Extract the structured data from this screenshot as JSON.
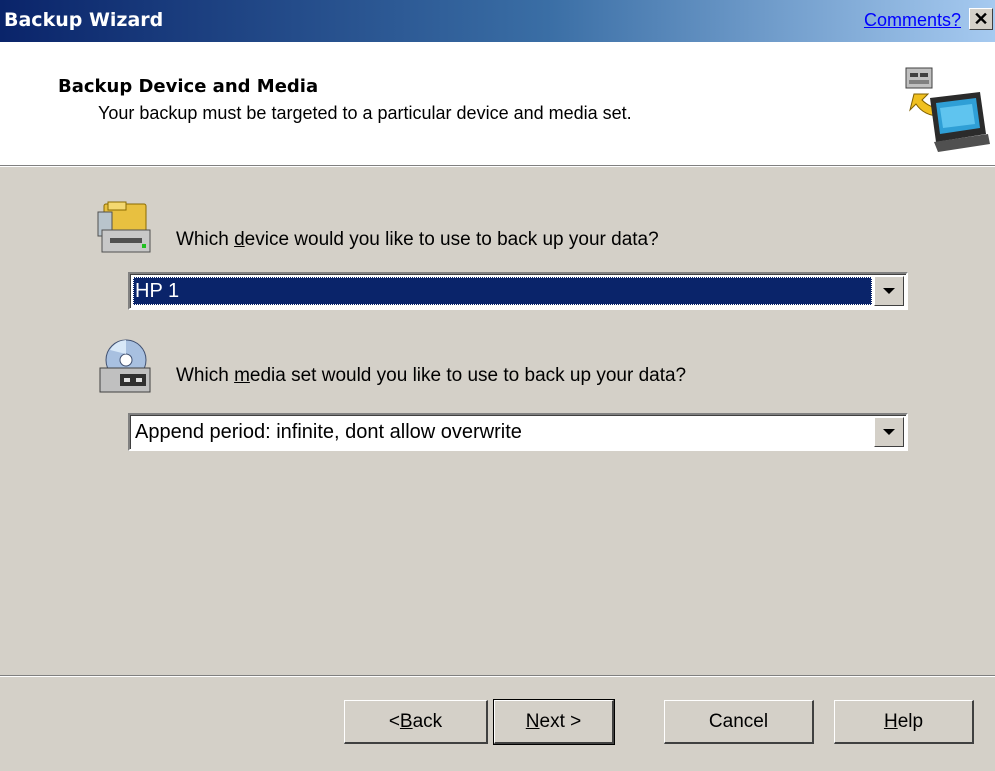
{
  "window": {
    "title": "Backup Wizard",
    "comments_link": "Comments?",
    "close_symbol": "✕"
  },
  "header": {
    "title": "Backup Device and Media",
    "subtitle": "Your backup must be targeted to a particular device and media set.",
    "icon": "backup-computer-icon"
  },
  "device_question": {
    "pre": "Which ",
    "mnemonic": "d",
    "post": "evice would you like to use to back up your data?",
    "icon": "device-icon"
  },
  "device_select": {
    "value": "HP 1",
    "selected": true
  },
  "media_question": {
    "pre": "Which ",
    "mnemonic": "m",
    "post": "edia set would you like to use to back up your data?",
    "icon": "media-set-icon"
  },
  "media_select": {
    "value": "Append period: infinite, dont allow overwrite"
  },
  "buttons": {
    "back": {
      "pre": "< ",
      "mnemonic": "B",
      "post": "ack"
    },
    "next": {
      "pre": "",
      "mnemonic": "N",
      "post": "ext >"
    },
    "cancel": {
      "label": "Cancel"
    },
    "help": {
      "pre": "",
      "mnemonic": "H",
      "post": "elp"
    }
  },
  "colors": {
    "dialog_bg": "#d4d0c8",
    "title_bar": "#0a246a",
    "selection": "#0a246a",
    "link": "#0000ff"
  }
}
